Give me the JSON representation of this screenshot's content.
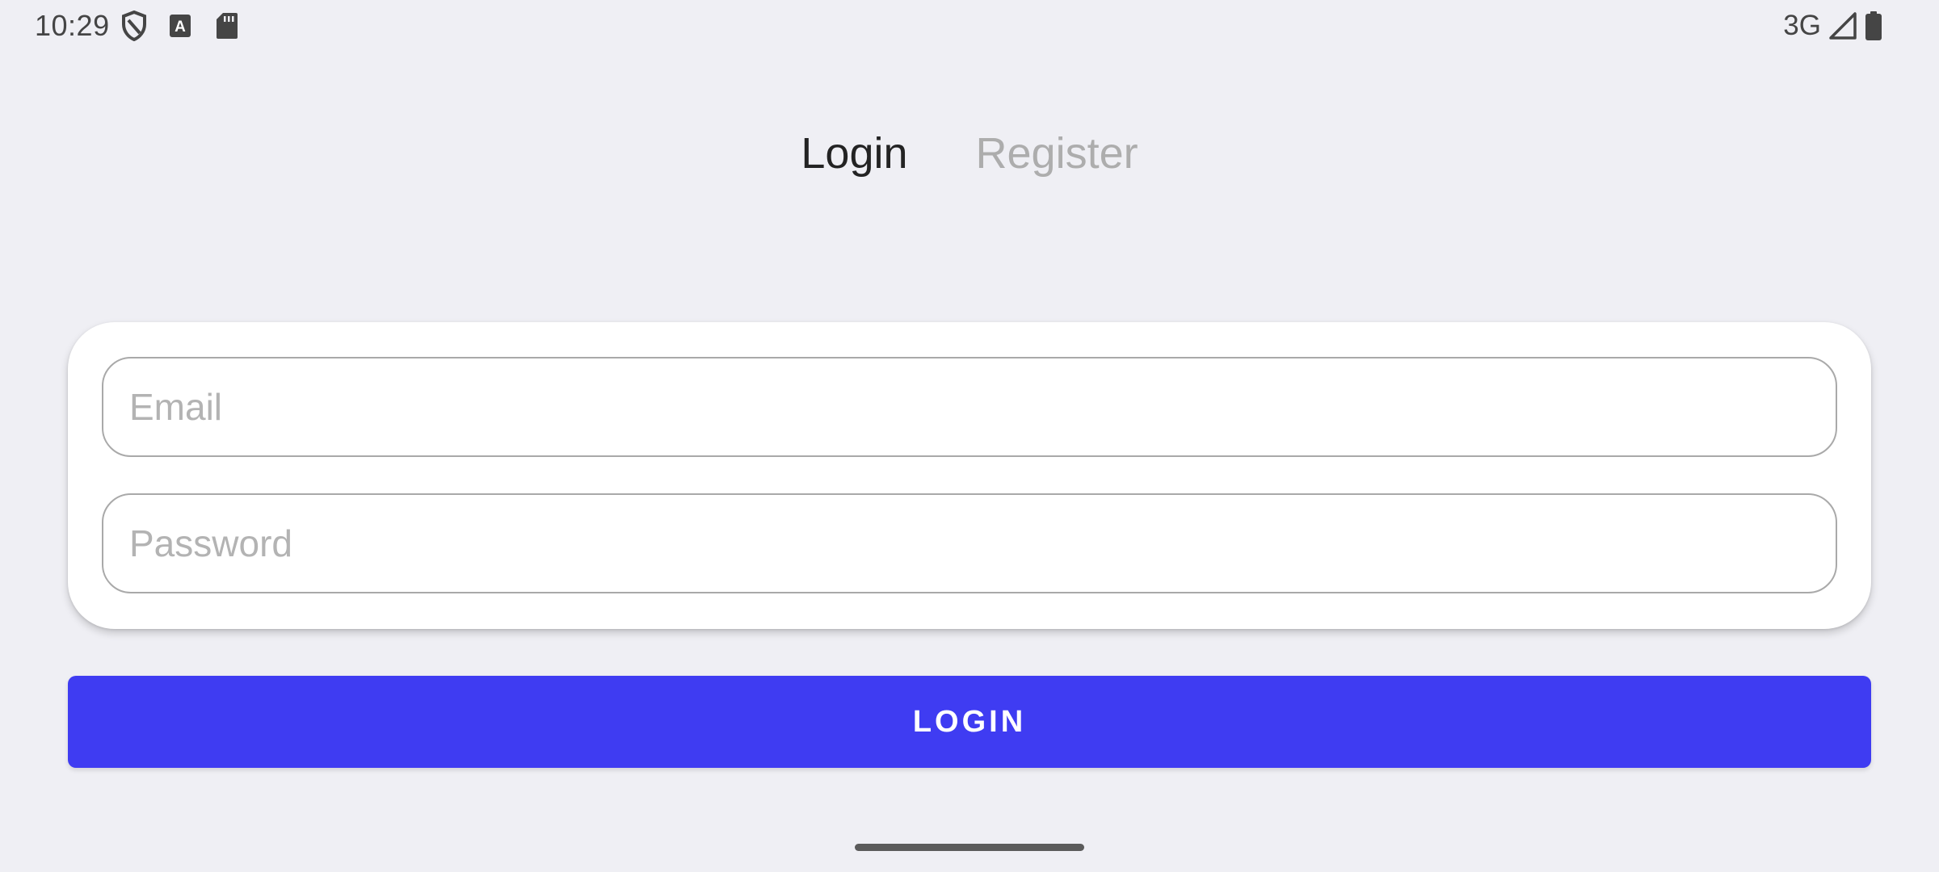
{
  "status_bar": {
    "time": "10:29",
    "left_icons": [
      "shield-icon",
      "keyboard-a-icon",
      "sd-card-icon"
    ],
    "network": "3G",
    "right_icons": [
      "cell-signal-icon",
      "battery-icon"
    ]
  },
  "tabs": [
    {
      "label": "Login",
      "active": true
    },
    {
      "label": "Register",
      "active": false
    }
  ],
  "form": {
    "email": {
      "placeholder": "Email",
      "value": ""
    },
    "password": {
      "placeholder": "Password",
      "value": ""
    }
  },
  "login_button": {
    "label": "LOGIN"
  },
  "colors": {
    "background": "#efeff4",
    "accent": "#3f3cf2",
    "tab_active": "#232323",
    "tab_inactive": "#adadad"
  }
}
